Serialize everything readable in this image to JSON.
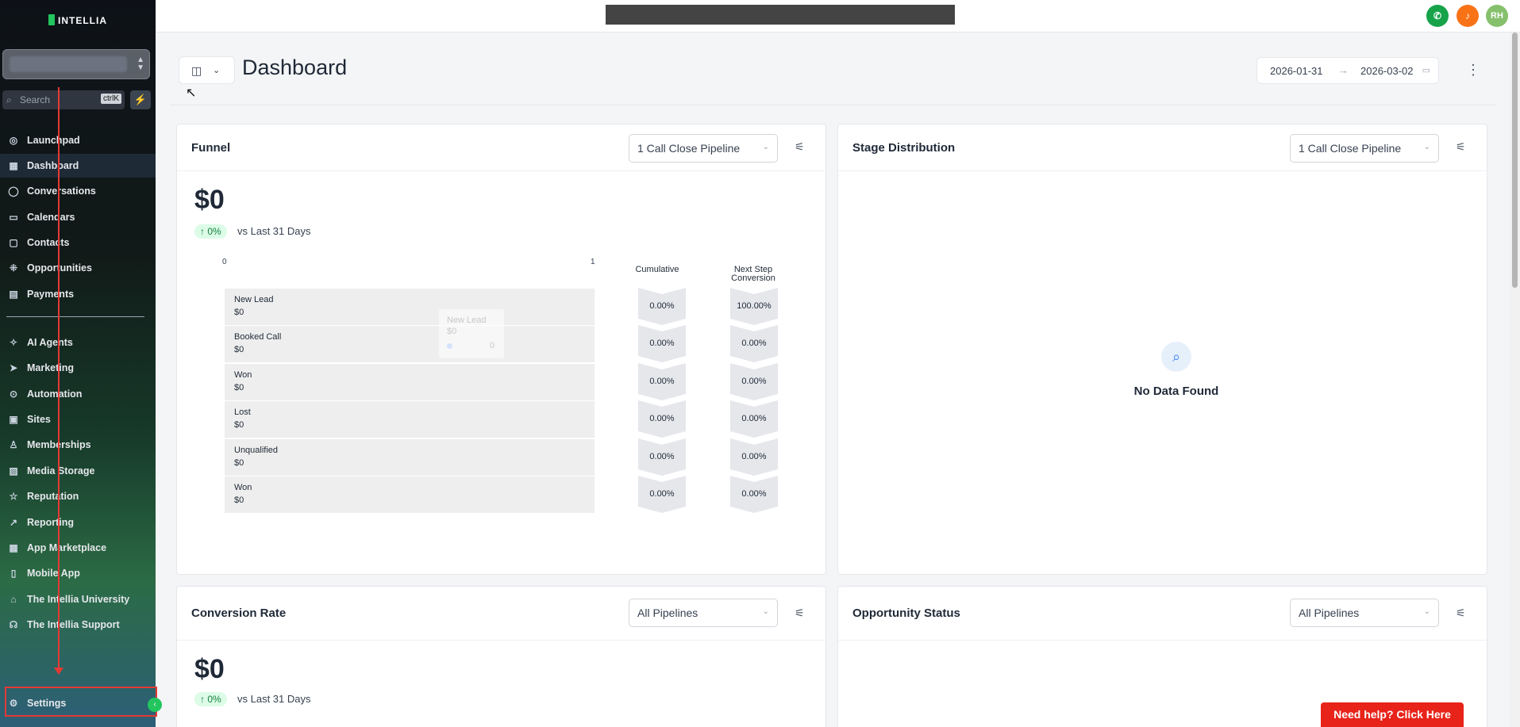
{
  "app": {
    "logo_text": "INTELLIA"
  },
  "sidebar": {
    "search_placeholder": "Search",
    "search_shortcut": "ctrlK",
    "items": [
      {
        "label": "Launchpad",
        "icon": "launchpad-icon"
      },
      {
        "label": "Dashboard",
        "icon": "dashboard-icon"
      },
      {
        "label": "Conversations",
        "icon": "chat-icon"
      },
      {
        "label": "Calendars",
        "icon": "calendar-icon"
      },
      {
        "label": "Contacts",
        "icon": "contacts-icon"
      },
      {
        "label": "Opportunities",
        "icon": "opportunities-icon"
      },
      {
        "label": "Payments",
        "icon": "payments-icon"
      },
      {
        "label": "AI Agents",
        "icon": "ai-agents-icon"
      },
      {
        "label": "Marketing",
        "icon": "marketing-icon"
      },
      {
        "label": "Automation",
        "icon": "automation-icon"
      },
      {
        "label": "Sites",
        "icon": "sites-icon"
      },
      {
        "label": "Memberships",
        "icon": "memberships-icon"
      },
      {
        "label": "Media Storage",
        "icon": "media-icon"
      },
      {
        "label": "Reputation",
        "icon": "star-icon"
      },
      {
        "label": "Reporting",
        "icon": "reporting-icon"
      },
      {
        "label": "App Marketplace",
        "icon": "marketplace-icon"
      },
      {
        "label": "Mobile App",
        "icon": "mobile-icon"
      },
      {
        "label": "The Intellia University",
        "icon": "university-icon"
      },
      {
        "label": "The Intellia Support",
        "icon": "support-icon"
      }
    ],
    "settings_label": "Settings"
  },
  "topbar": {
    "avatar_initials": "RH"
  },
  "header": {
    "title": "Dashboard",
    "date_start": "2026-01-31",
    "date_end": "2026-03-02"
  },
  "funnel": {
    "title": "Funnel",
    "pipeline": "1 Call Close Pipeline",
    "total": "$0",
    "change": "↑ 0%",
    "vs": "vs Last 31 Days",
    "axis_min": "0",
    "axis_max": "1",
    "col_cumulative": "Cumulative",
    "col_next_step": "Next Step Conversion",
    "stages": [
      {
        "name": "New Lead",
        "value": "$0",
        "cumulative": "0.00%",
        "next": "100.00%"
      },
      {
        "name": "Booked Call",
        "value": "$0",
        "cumulative": "0.00%",
        "next": "0.00%"
      },
      {
        "name": "Won",
        "value": "$0",
        "cumulative": "0.00%",
        "next": "0.00%"
      },
      {
        "name": "Lost",
        "value": "$0",
        "cumulative": "0.00%",
        "next": "0.00%"
      },
      {
        "name": "Unqualified",
        "value": "$0",
        "cumulative": "0.00%",
        "next": "0.00%"
      },
      {
        "name": "Won",
        "value": "$0",
        "cumulative": "0.00%",
        "next": "0.00%"
      }
    ],
    "tooltip": {
      "stage": "New Lead",
      "value": "$0",
      "count": "0"
    }
  },
  "stage_distribution": {
    "title": "Stage Distribution",
    "pipeline": "1 Call Close Pipeline",
    "empty_text": "No Data Found"
  },
  "conversion_rate": {
    "title": "Conversion Rate",
    "pipeline": "All Pipelines",
    "total": "$0",
    "change": "↑ 0%",
    "vs": "vs Last 31 Days"
  },
  "opportunity_status": {
    "title": "Opportunity Status",
    "pipeline": "All Pipelines"
  },
  "help_button": "Need help? Click Here",
  "colors": {
    "accent_green": "#22c55e",
    "help_red": "#e8231a",
    "annotation_red": "#e53935"
  }
}
